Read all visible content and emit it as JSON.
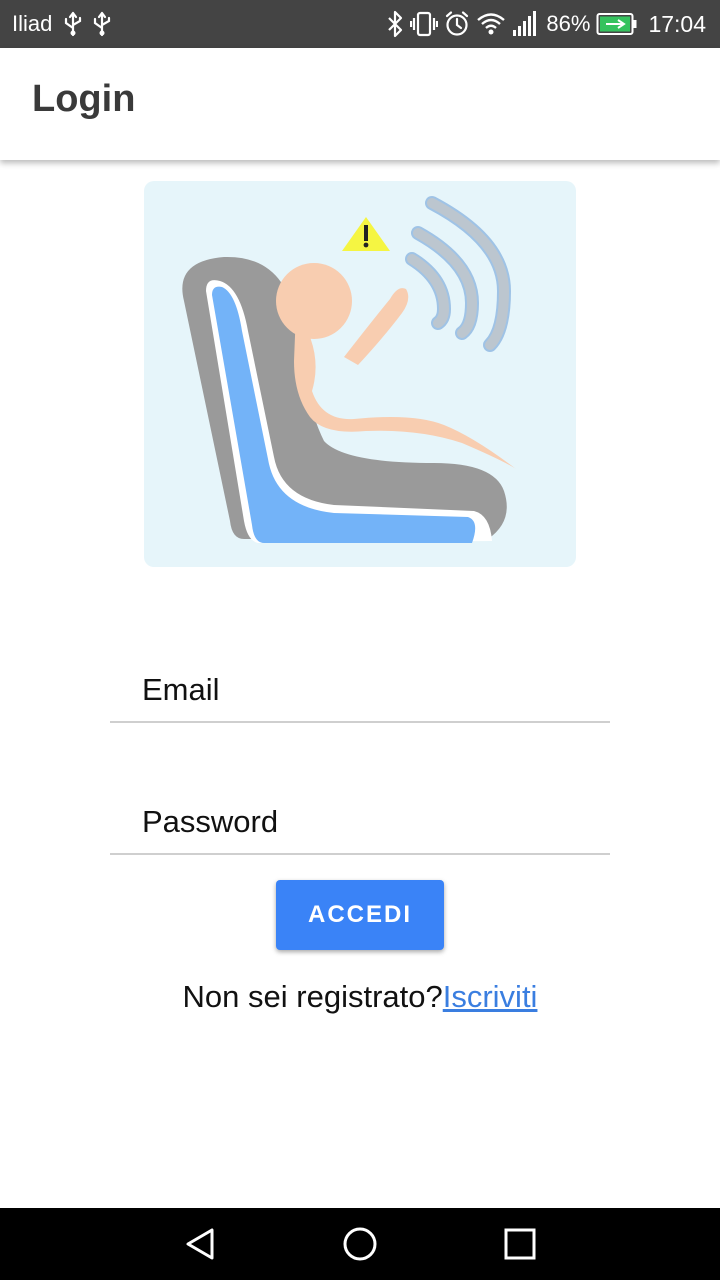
{
  "status_bar": {
    "carrier": "Iliad",
    "battery_percent": "86%",
    "time": "17:04"
  },
  "app_bar": {
    "title": "Login"
  },
  "form": {
    "email_placeholder": "Email",
    "password_placeholder": "Password",
    "submit_label": "ACCEDI",
    "register_prompt": "Non sei registrato?",
    "register_link": "Iscriviti"
  },
  "colors": {
    "status_bar": "#444444",
    "accent": "#3a83f7",
    "link": "#3a7ee0",
    "hero_background": "#e6f5fa"
  },
  "icons": {
    "status_left": [
      "usb-icon",
      "usb-icon"
    ],
    "status_right": [
      "bluetooth-icon",
      "vibrate-icon",
      "alarm-icon",
      "wifi-icon",
      "signal-icon",
      "battery-charging-icon"
    ],
    "navigation": [
      "back-icon",
      "home-icon",
      "recents-icon"
    ]
  }
}
